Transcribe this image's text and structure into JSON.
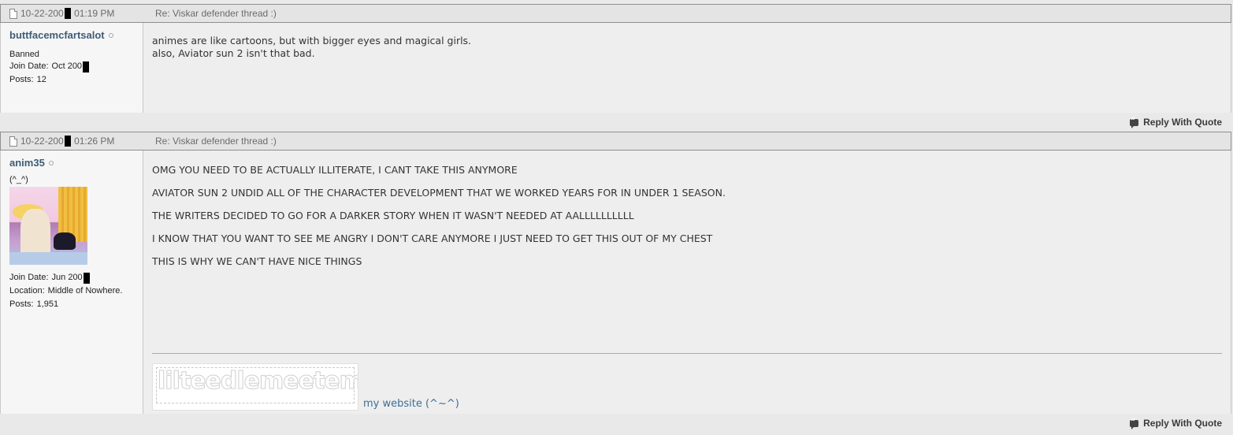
{
  "posts": [
    {
      "date_prefix": "10-22-200",
      "time": "01:19 PM",
      "title": "Re: Viskar defender thread :)",
      "username": "buttfacemcfartsalot",
      "user_title": "Banned",
      "join_label": "Join Date:",
      "join_value": "Oct 200",
      "posts_label": "Posts:",
      "posts_value": "12",
      "lines": [
        "animes are like cartoons, but with bigger eyes and magical girls.",
        "also, Aviator sun 2 isn't that bad."
      ],
      "reply_label": "Reply With Quote"
    },
    {
      "date_prefix": "10-22-200",
      "time": "01:26 PM",
      "title": "Re: Viskar defender thread :)",
      "username": "anim35",
      "user_title": "(^_^)",
      "join_label": "Join Date:",
      "join_value": "Jun 200",
      "location_label": "Location:",
      "location_value": "Middle of Nowhere.",
      "posts_label": "Posts:",
      "posts_value": "1,951",
      "lines": [
        "OMG YOU NEED TO BE ACTUALLY ILLITERATE, I CANT TAKE THIS ANYMORE",
        "AVIATOR SUN 2 UNDID ALL OF THE CHARACTER DEVELOPMENT THAT WE WORKED YEARS FOR IN UNDER 1 SEASON.",
        "THE WRITERS DECIDED TO GO FOR A DARKER STORY WHEN IT WASN'T NEEDED AT AALLLLLLLLLL",
        "I KNOW THAT YOU WANT TO SEE ME ANGRY I DON'T CARE ANYMORE I JUST NEED TO GET THIS OUT OF MY CHEST",
        "THIS IS WHY WE CAN'T HAVE NICE THINGS"
      ],
      "signature_image_text": "lilteedlemeetem",
      "signature_link": "my website (^~^)",
      "reply_label": "Reply With Quote"
    }
  ],
  "colors": {
    "username": "#3e5c76",
    "link": "#3e6e95",
    "header_bg": "#e4e4e4",
    "content_bg": "#eeeeee",
    "userinfo_bg": "#f6f6f6"
  }
}
